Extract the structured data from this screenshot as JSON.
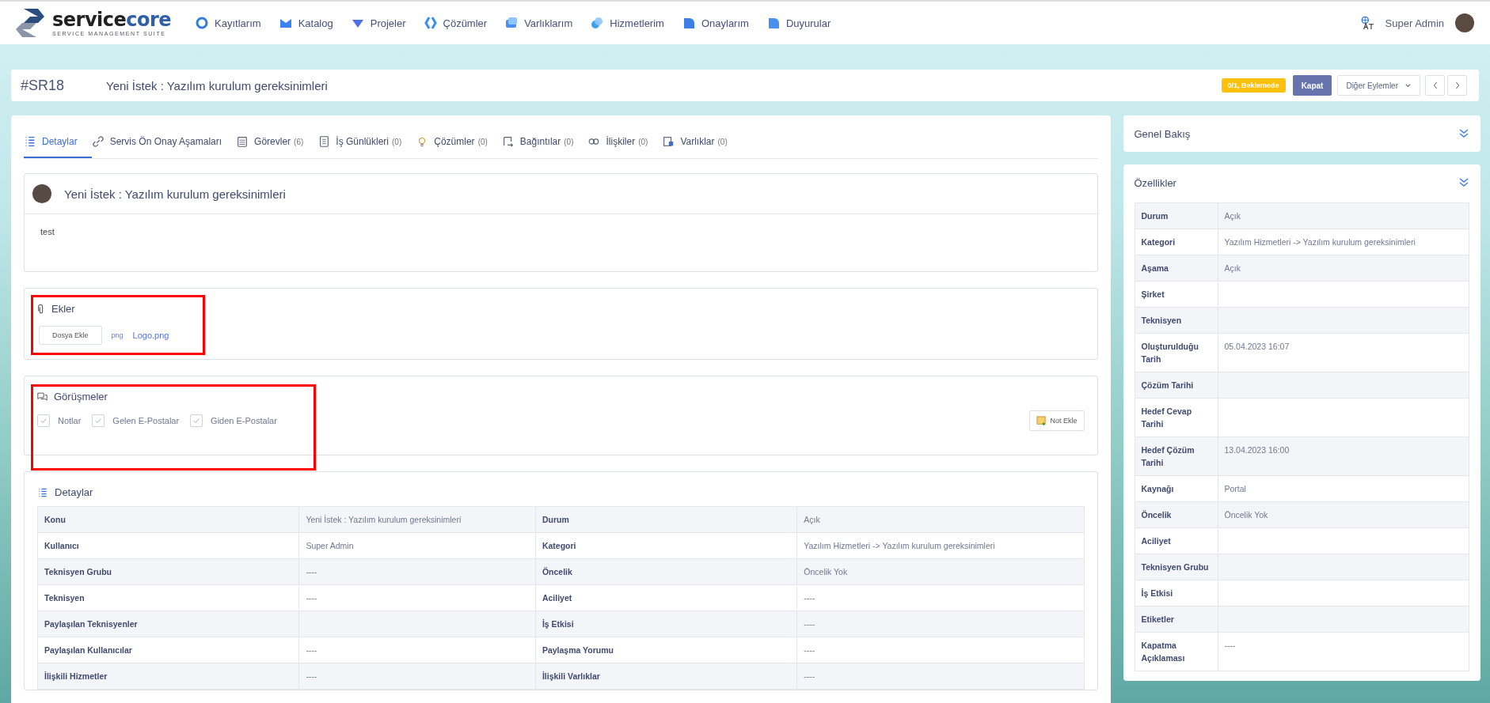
{
  "nav": {
    "brand": [
      "service",
      "core"
    ],
    "tagline": "SERVICE MANAGEMENT SUITE",
    "items": [
      "Kayıtlarım",
      "Katalog",
      "Projeler",
      "Çözümler",
      "Varlıklarım",
      "Hizmetlerim",
      "Onaylarım",
      "Duyurular"
    ],
    "user": "Super Admin"
  },
  "header": {
    "id": "#SR18",
    "title": "Yeni İstek : Yazılım kurulum gereksinimleri",
    "status_badge": "0/1, Beklemede",
    "close_button": "Kapat",
    "actions_button": "Diğer Eylemler"
  },
  "tabs": [
    {
      "label": "Detaylar",
      "selected": true
    },
    {
      "label": "Servis Ön Onay Aşamaları",
      "selected": false
    },
    {
      "label": "Görevler",
      "count": "(6)",
      "selected": false
    },
    {
      "label": "İş Günlükleri",
      "count": "(0)",
      "selected": false
    },
    {
      "label": "Çözümler",
      "count": "(0)",
      "selected": false
    },
    {
      "label": "Bağıntılar",
      "count": "(0)",
      "selected": false
    },
    {
      "label": "İlişkiler",
      "count": "(0)",
      "selected": false
    },
    {
      "label": "Varlıklar",
      "count": "(0)",
      "selected": false
    }
  ],
  "request": {
    "title": "Yeni İstek : Yazılım kurulum gereksinimleri",
    "body": "test"
  },
  "attachments": {
    "title": "Ekler",
    "add_button": "Dosya Ekle",
    "files": [
      {
        "type": "png",
        "name": "Logo.png"
      }
    ]
  },
  "conversations": {
    "title": "Görüşmeler",
    "filters": [
      {
        "label": "Notlar",
        "checked": true
      },
      {
        "label": "Gelen E-Postalar",
        "checked": true
      },
      {
        "label": "Giden E-Postalar",
        "checked": true
      }
    ],
    "add_note_button": "Not Ekle"
  },
  "details": {
    "title": "Detaylar",
    "rows": [
      {
        "label": "Konu",
        "value": "Yeni İstek : Yazılım kurulum gereksinimleri",
        "label_2": "Durum",
        "value_2": "Açık"
      },
      {
        "label": "Kullanıcı",
        "value": "Super Admin",
        "label_2": "Kategori",
        "value_2": "Yazılım Hizmetleri -> Yazılım kurulum gereksinimleri"
      },
      {
        "label": "Teknisyen Grubu",
        "value": "----",
        "label_2": "Öncelik",
        "value_2": "Öncelik Yok"
      },
      {
        "label": "Teknisyen",
        "value": "----",
        "label_2": "Aciliyet",
        "value_2": "----"
      },
      {
        "label": "Paylaşılan Teknisyenler",
        "label_2": "İş Etkisi",
        "value_2": "----"
      },
      {
        "label": "Paylaşılan Kullanıcılar",
        "value": "----",
        "label_2": "Paylaşma Yorumu",
        "value_2": "----"
      },
      {
        "label": "İlişkili Hizmetler",
        "value": "----",
        "label_2": "İlişkili Varlıklar",
        "value_2": "----"
      }
    ]
  },
  "overview": {
    "title": "Genel Bakış"
  },
  "properties": {
    "title": "Özellikler",
    "rows": [
      {
        "label": "Durum",
        "value": "Açık"
      },
      {
        "label": "Kategori",
        "value": "Yazılım Hizmetleri -> Yazılım kurulum gereksinimleri"
      },
      {
        "label": "Aşama",
        "value": "Açık"
      },
      {
        "label": "Şirket"
      },
      {
        "label": "Teknisyen"
      },
      {
        "label": "Oluşturulduğu Tarih",
        "value": "05.04.2023 16:07"
      },
      {
        "label": "Çözüm Tarihi"
      },
      {
        "label": "Hedef Cevap Tarihi"
      },
      {
        "label": "Hedef Çözüm Tarihi",
        "value": "13.04.2023 16:00"
      },
      {
        "label": "Kaynağı",
        "value": "Portal"
      },
      {
        "label": "Öncelik",
        "value": "Öncelik Yok"
      },
      {
        "label": "Aciliyet"
      },
      {
        "label": "Teknisyen Grubu"
      },
      {
        "label": "İş Etkisi"
      },
      {
        "label": "Etiketler"
      },
      {
        "label": "Kapatma Açıklaması",
        "value": "----"
      }
    ]
  }
}
